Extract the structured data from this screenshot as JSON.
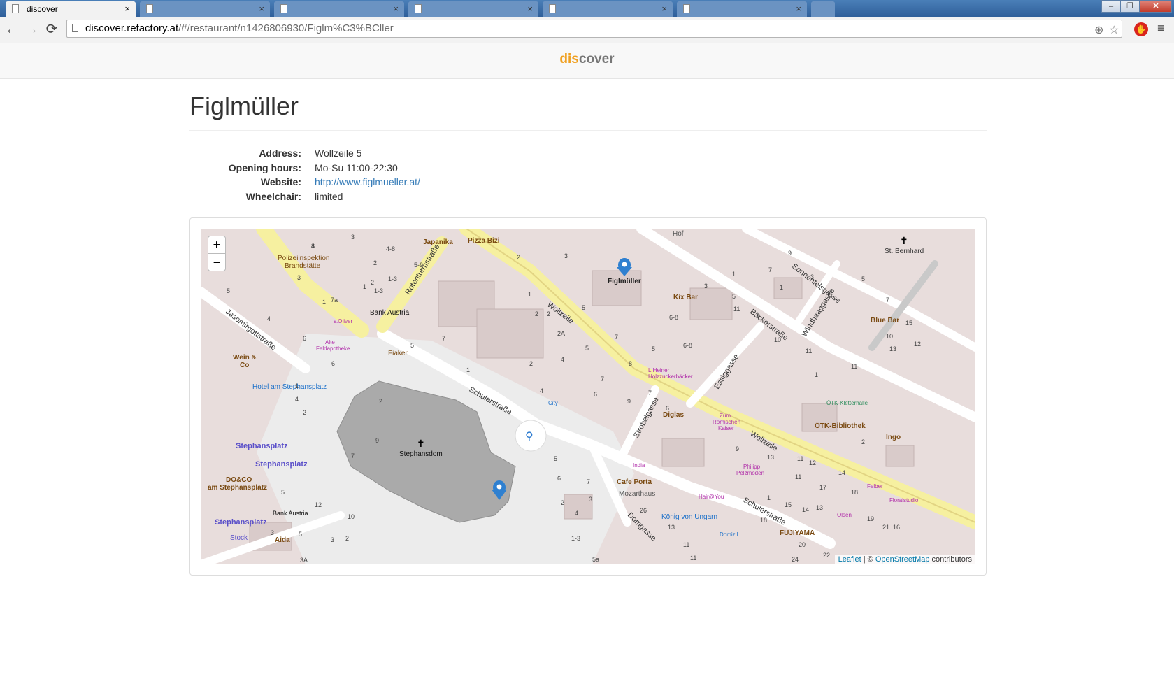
{
  "browser": {
    "tabs": [
      {
        "title": "discover",
        "active": true
      },
      {
        "title": "",
        "active": false
      },
      {
        "title": "",
        "active": false
      },
      {
        "title": "",
        "active": false
      },
      {
        "title": "",
        "active": false
      },
      {
        "title": "",
        "active": false
      }
    ],
    "tab_close": "×",
    "url_host": "discover.refactory.at",
    "url_path": "/#/restaurant/n1426806930/Figlm%C3%BCller",
    "controls": {
      "back": "←",
      "forward": "→",
      "reload": "⟳",
      "minimize": "‒",
      "maximize": "❐",
      "close": "✕",
      "menu": "≡",
      "star": "☆",
      "location": "⊕"
    }
  },
  "site": {
    "brand_accent": "dis",
    "brand_rest": "cover",
    "accent_color": "#f0a020"
  },
  "restaurant": {
    "name": "Figlmüller",
    "details": [
      {
        "label": "Address:",
        "value": "Wollzeile 5"
      },
      {
        "label": "Opening hours:",
        "value": "Mo-Su 11:00-22:30"
      },
      {
        "label": "Website:",
        "value": "http://www.figlmueller.at/"
      },
      {
        "label": "Wheelchair:",
        "value": "limited"
      }
    ]
  },
  "map": {
    "zoom_in": "+",
    "zoom_out": "−",
    "attribution": {
      "leaflet": "Leaflet",
      "sep": " | © ",
      "osm": "OpenStreetMap",
      "suffix": " contributors"
    },
    "streets": [
      "Wollzeile",
      "Wollzeile",
      "Schulerstraße",
      "Schulerstraße",
      "Rotenturmstraße",
      "Jasomirgottstraße",
      "Bäckerstraße",
      "Sonnenfelsgasse",
      "Windhaaggasse",
      "Essiggasse",
      "Strobelgasse",
      "Domgasse"
    ],
    "labels": [
      "Japanika",
      "Pizza Bizi",
      "Hof",
      "St. Bernhard",
      "Polizeiinspektion",
      "Brandstätte",
      "Bank Austria",
      "Figlmüller",
      "Kix Bar",
      "Blue Bar",
      "s.Oliver",
      "Alte",
      "Feldapotheke",
      "Wein &",
      "Co",
      "Fiaker",
      "Hotel am Stephansplatz",
      "L.Heiner",
      "Holzzuckerbäcker",
      "City",
      "Diglas",
      "Zum",
      "Römischen",
      "Kaiser",
      "ÖTK-Kletterhalle",
      "ÖTK-Bibliothek",
      "Ingo",
      "Stephansplatz",
      "Stephansplatz",
      "Stephansdom",
      "DO&CO",
      "am Stephansplatz",
      "India",
      "Cafe Porta",
      "Mozarthaus",
      "Hair@You",
      "Philipp",
      "Pelzmoden",
      "Felber",
      "Floralstudio",
      "König von Ungarn",
      "Domizil",
      "Olsen",
      "Bank Austria",
      "Stephansplatz",
      "Stock",
      "Aida",
      "FUJIYAMA"
    ],
    "numbers": [
      "4",
      "3",
      "2",
      "4-8",
      "1-3",
      "5-9",
      "1",
      "1-3",
      "7a",
      "2",
      "3",
      "5",
      "4",
      "1",
      "6",
      "6",
      "2",
      "4",
      "1",
      "2",
      "3",
      "1",
      "2",
      "2",
      "2A",
      "4",
      "5",
      "5",
      "7",
      "8",
      "9",
      "7",
      "6",
      "5",
      "6-8",
      "6-8",
      "3",
      "1",
      "5",
      "11",
      "9",
      "10",
      "11",
      "9",
      "7",
      "1",
      "3",
      "5",
      "7",
      "10",
      "12",
      "13",
      "15",
      "11",
      "1",
      "2",
      "11",
      "12",
      "14",
      "9",
      "13",
      "11",
      "1",
      "15",
      "17",
      "18",
      "19",
      "21",
      "16",
      "13",
      "14",
      "18",
      "20",
      "22",
      "24",
      "26",
      "11",
      "11",
      "13",
      "5",
      "6",
      "7",
      "3",
      "4",
      "1-3",
      "5a",
      "2",
      "3",
      "2",
      "5",
      "10",
      "12",
      "3A",
      "3",
      "5",
      "7",
      "9",
      "2",
      "5",
      "7",
      "1",
      "2",
      "4",
      "6",
      "7",
      "8"
    ]
  }
}
